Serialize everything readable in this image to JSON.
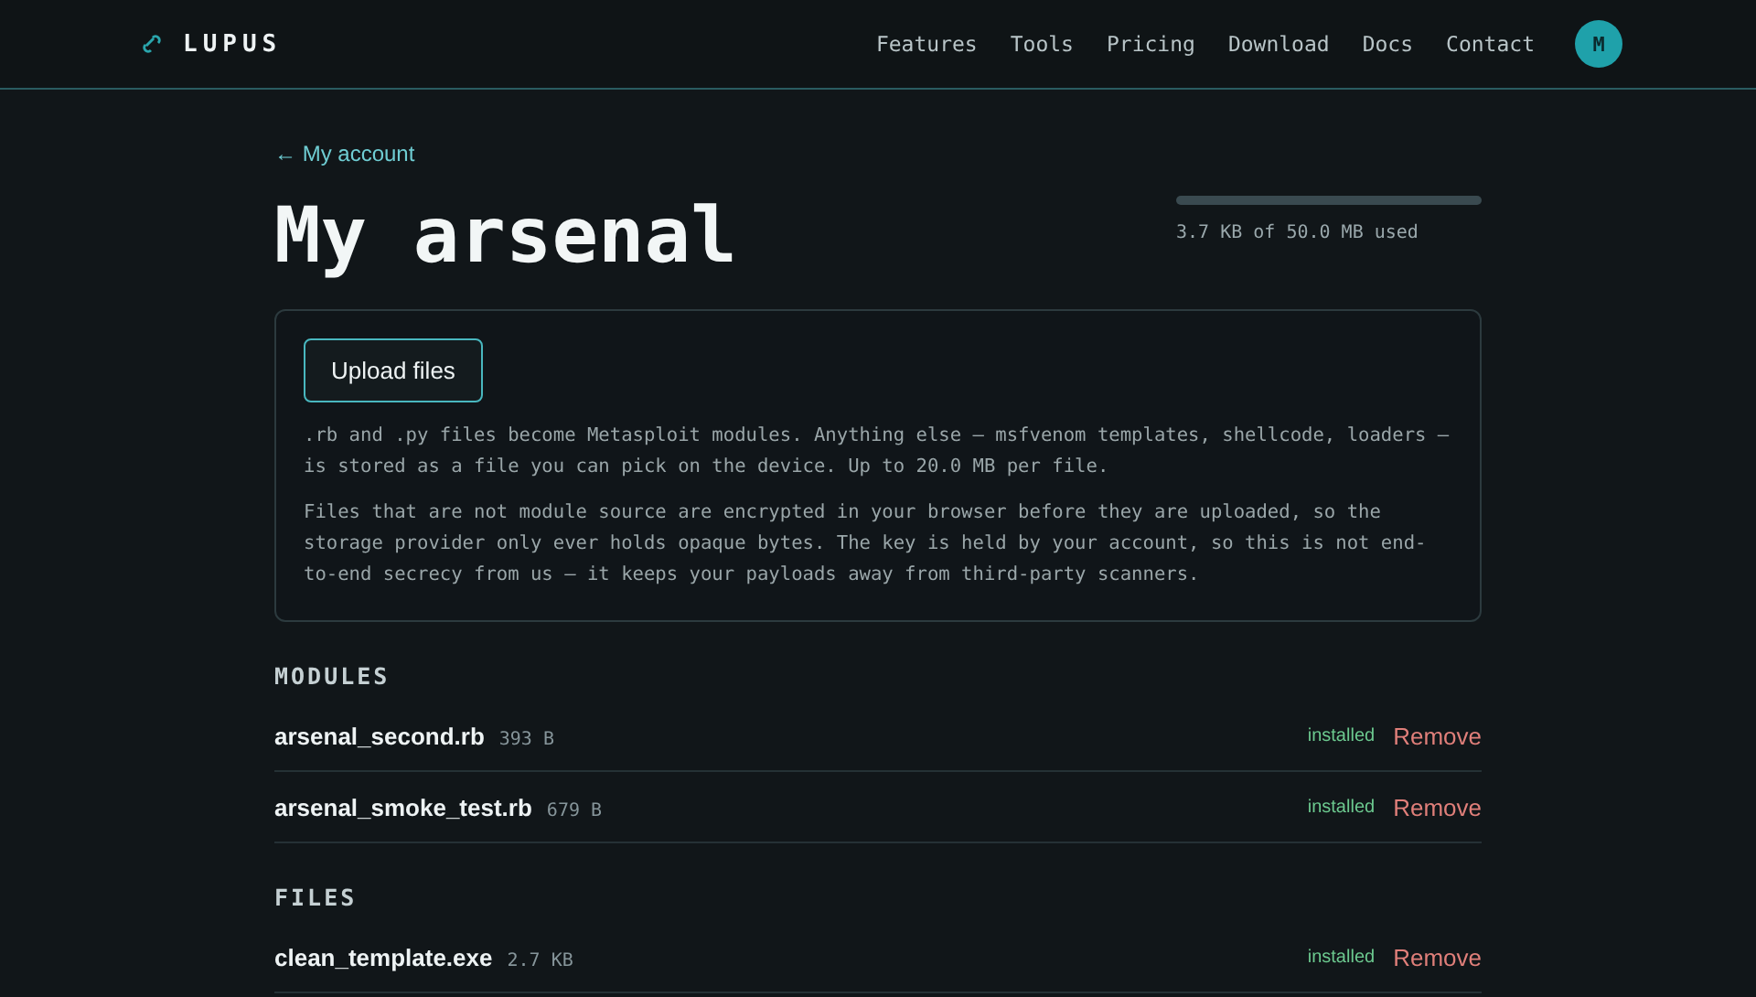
{
  "header": {
    "logo": "LUPUS",
    "nav": [
      {
        "label": "Features"
      },
      {
        "label": "Tools"
      },
      {
        "label": "Pricing"
      },
      {
        "label": "Download"
      },
      {
        "label": "Docs"
      },
      {
        "label": "Contact"
      }
    ],
    "avatar": "M"
  },
  "back_link": "← My account",
  "title": "My arsenal",
  "storage": {
    "level": 0.0001,
    "reading": "3.7 KB of 50.0 MB used"
  },
  "upload": {
    "button": "Upload files",
    "paragraphs": [
      ".rb and .py files become Metasploit modules. Anything else — msfvenom templates, shellcode, loaders — is stored as a file you can pick on the device. Up to 20.0 MB per file.",
      "Files that are not module source are encrypted in your browser before they are uploaded, so the storage provider only ever holds opaque bytes. The key is held by your account, so this is not end-to-end secrecy from us — it keeps your payloads away from third-party scanners."
    ]
  },
  "sections": [
    {
      "heading": "MODULES",
      "items": [
        {
          "name": "arsenal_second.rb",
          "size": "393 B",
          "status": "installed",
          "action": "Remove"
        },
        {
          "name": "arsenal_smoke_test.rb",
          "size": "679 B",
          "status": "installed",
          "action": "Remove"
        }
      ]
    },
    {
      "heading": "FILES",
      "items": [
        {
          "name": "clean_template.exe",
          "size": "2.7 KB",
          "status": "installed",
          "action": "Remove"
        }
      ]
    }
  ]
}
